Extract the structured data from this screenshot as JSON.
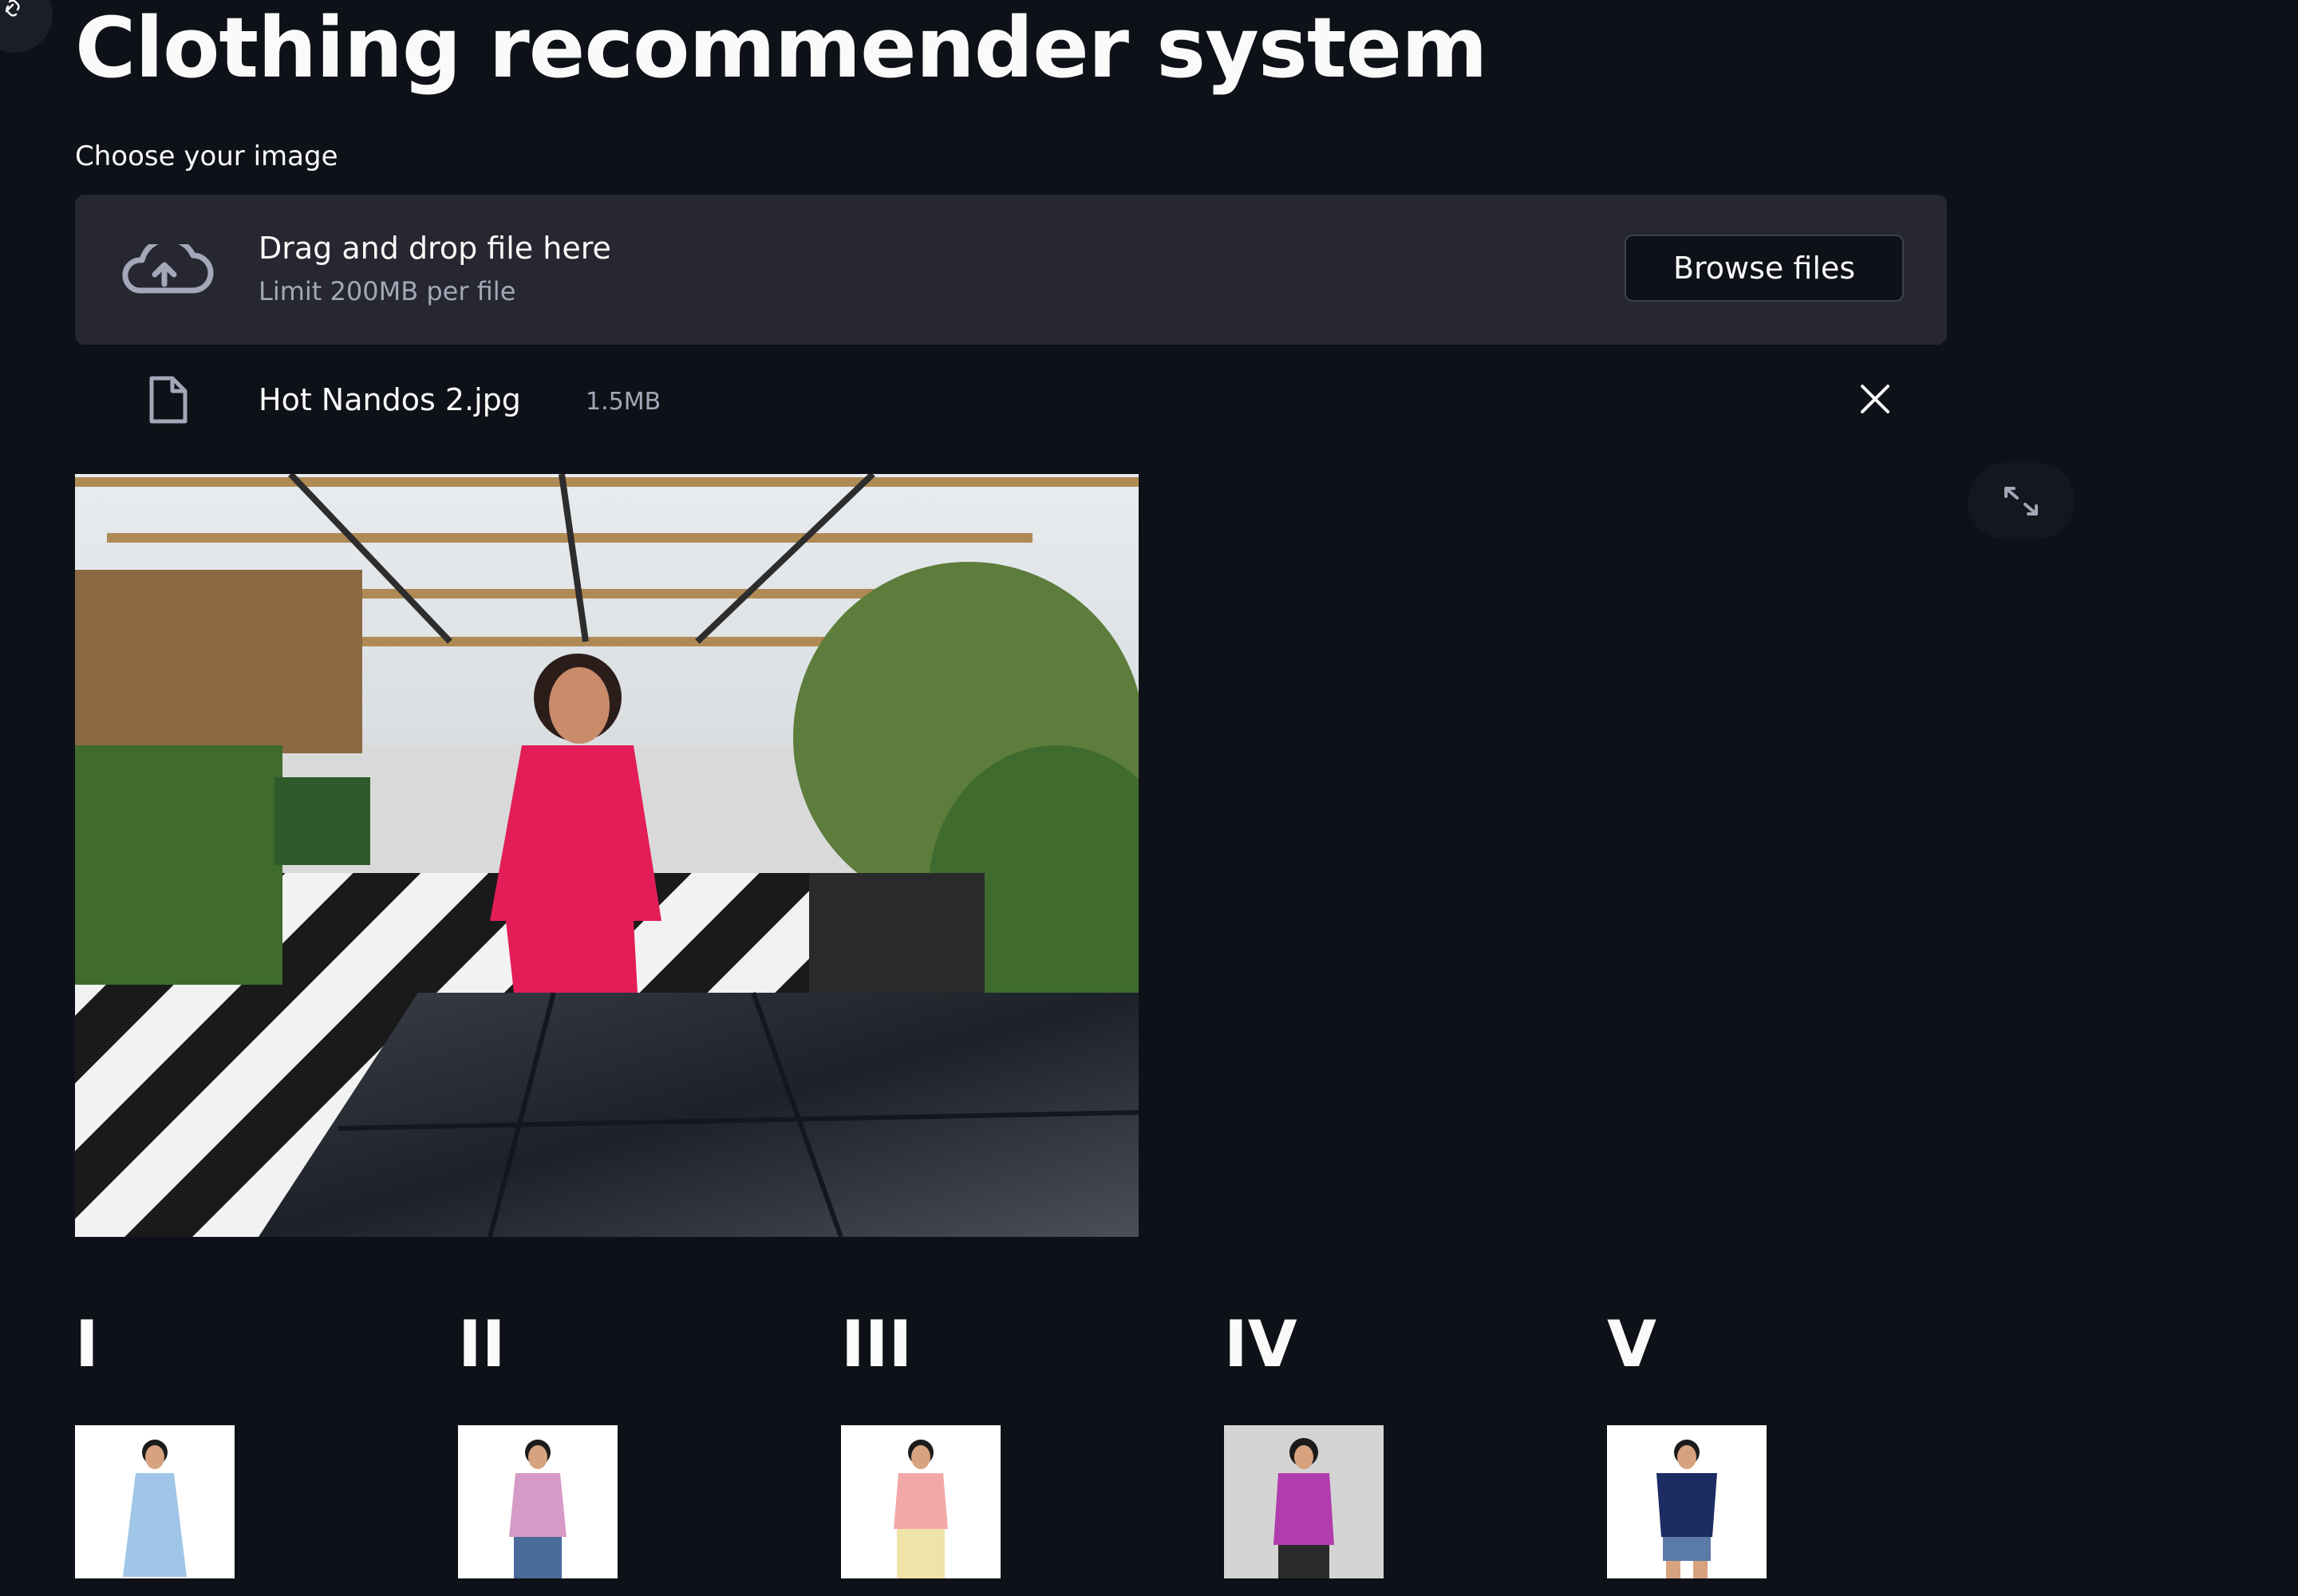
{
  "app": {
    "title": "Clothing recommender system"
  },
  "uploader": {
    "label": "Choose your image",
    "drop_text": "Drag and drop file here",
    "limit_text": "Limit 200MB per file",
    "browse_label": "Browse files",
    "uploaded_file": {
      "name": "Hot Nandos 2.jpg",
      "size": "1.5MB"
    }
  },
  "icons": {
    "corner": "link-icon",
    "upload": "cloud-upload-icon",
    "file": "file-icon",
    "remove": "close-icon",
    "fullscreen": "fullscreen-icon"
  },
  "results": [
    {
      "heading": "I",
      "shirt_color": "#9fc6e6"
    },
    {
      "heading": "II",
      "shirt_color": "#d69ac6"
    },
    {
      "heading": "III",
      "shirt_color": "#f2a8a8"
    },
    {
      "heading": "IV",
      "shirt_color": "#b23cae"
    },
    {
      "heading": "V",
      "shirt_color": "#1d2c63"
    }
  ],
  "colors": {
    "background": "#0e1117",
    "dropzone": "#262730",
    "text": "#fafafa",
    "muted": "#a3a8b8"
  }
}
